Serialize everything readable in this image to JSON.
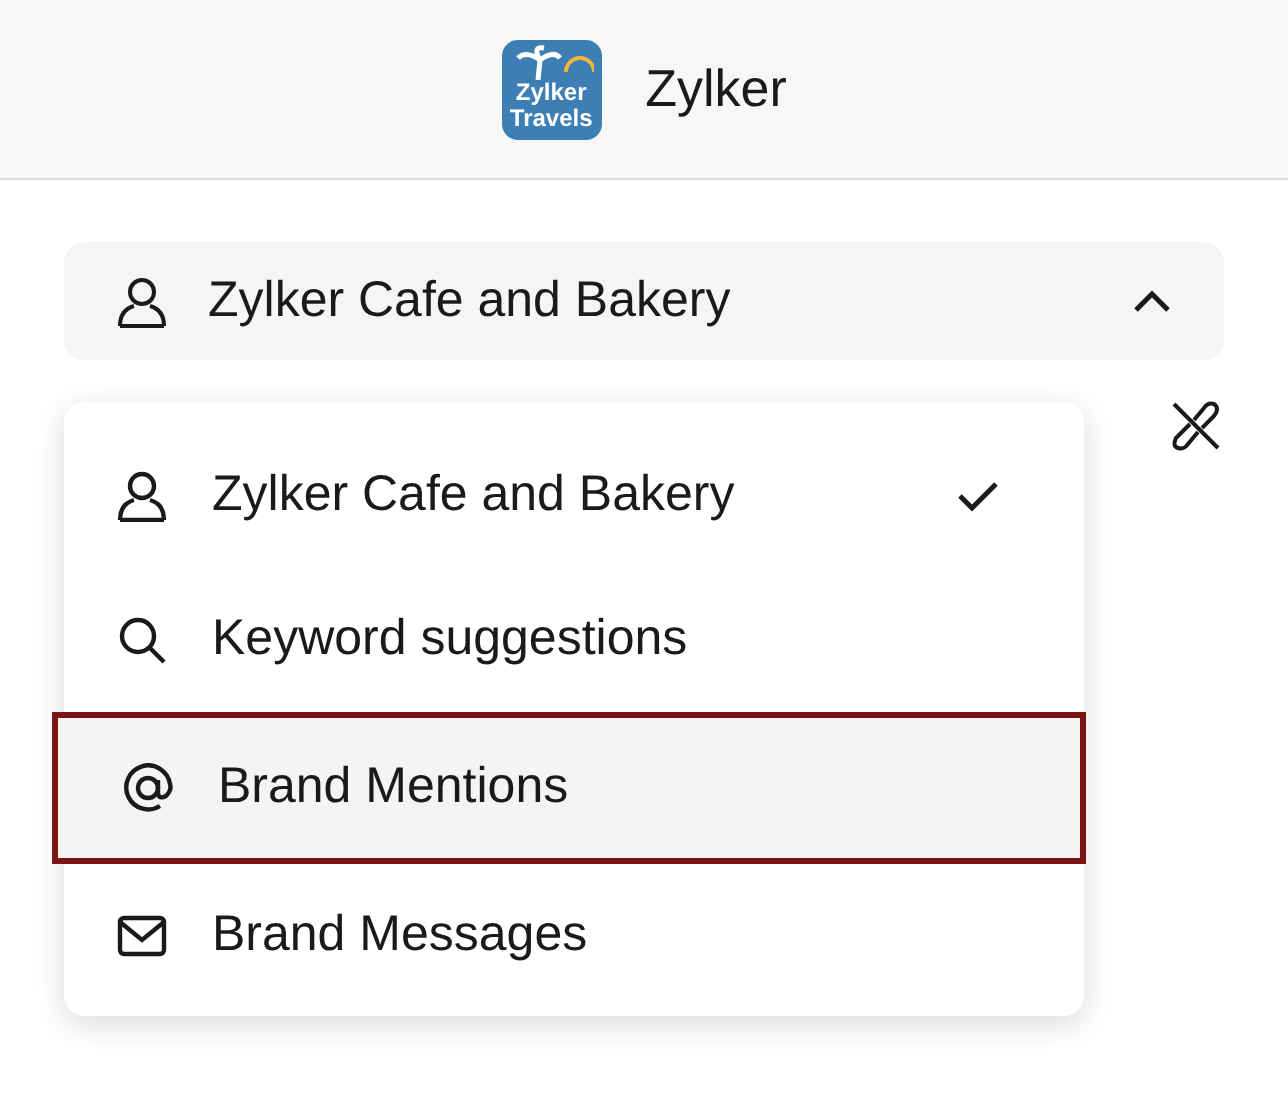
{
  "header": {
    "logo_lines": [
      "Zylker",
      "Travels"
    ],
    "title": "Zylker"
  },
  "account_select": {
    "value": "Zylker Cafe and Bakery",
    "expanded": true
  },
  "menu": [
    {
      "kind": "profile",
      "label": "Zylker Cafe and Bakery",
      "selected": true,
      "highlighted": false
    },
    {
      "kind": "search",
      "label": "Keyword suggestions",
      "selected": false,
      "highlighted": false
    },
    {
      "kind": "mention",
      "label": "Brand Mentions",
      "selected": false,
      "highlighted": true
    },
    {
      "kind": "mail",
      "label": "Brand Messages",
      "selected": false,
      "highlighted": false
    }
  ]
}
